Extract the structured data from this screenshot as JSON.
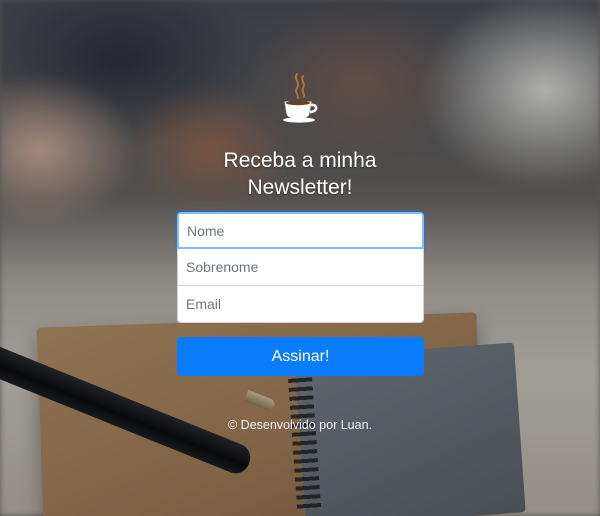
{
  "logo": {
    "icon": "coffee-cup-icon"
  },
  "title_line1": "Receba a minha",
  "title_line2": "Newsletter!",
  "form": {
    "name_placeholder": "Nome",
    "surname_placeholder": "Sobrenome",
    "email_placeholder": "Email",
    "submit_label": "Assinar!"
  },
  "footer": "© Desenvolvido por Luan.",
  "colors": {
    "accent": "#0a7cff",
    "focus_border": "#80bdff"
  }
}
